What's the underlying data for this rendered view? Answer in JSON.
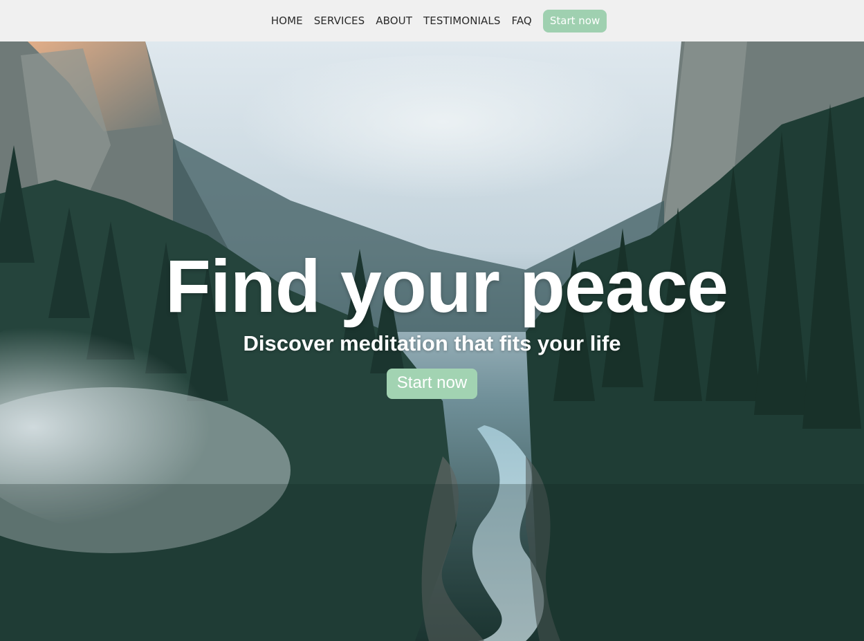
{
  "nav": {
    "links": [
      "HOME",
      "SERVICES",
      "ABOUT",
      "TESTIMONIALS",
      "FAQ"
    ],
    "cta_label": "Start now"
  },
  "hero": {
    "title": "Find your peace",
    "subtitle": "Discover meditation that fits your life",
    "cta_label": "Start now",
    "background_image": "misty-forest-valley-river"
  },
  "colors": {
    "accent": "#a2d3b2",
    "nav_bg": "#f0f0f0",
    "text_dark": "#2a2a2a"
  }
}
